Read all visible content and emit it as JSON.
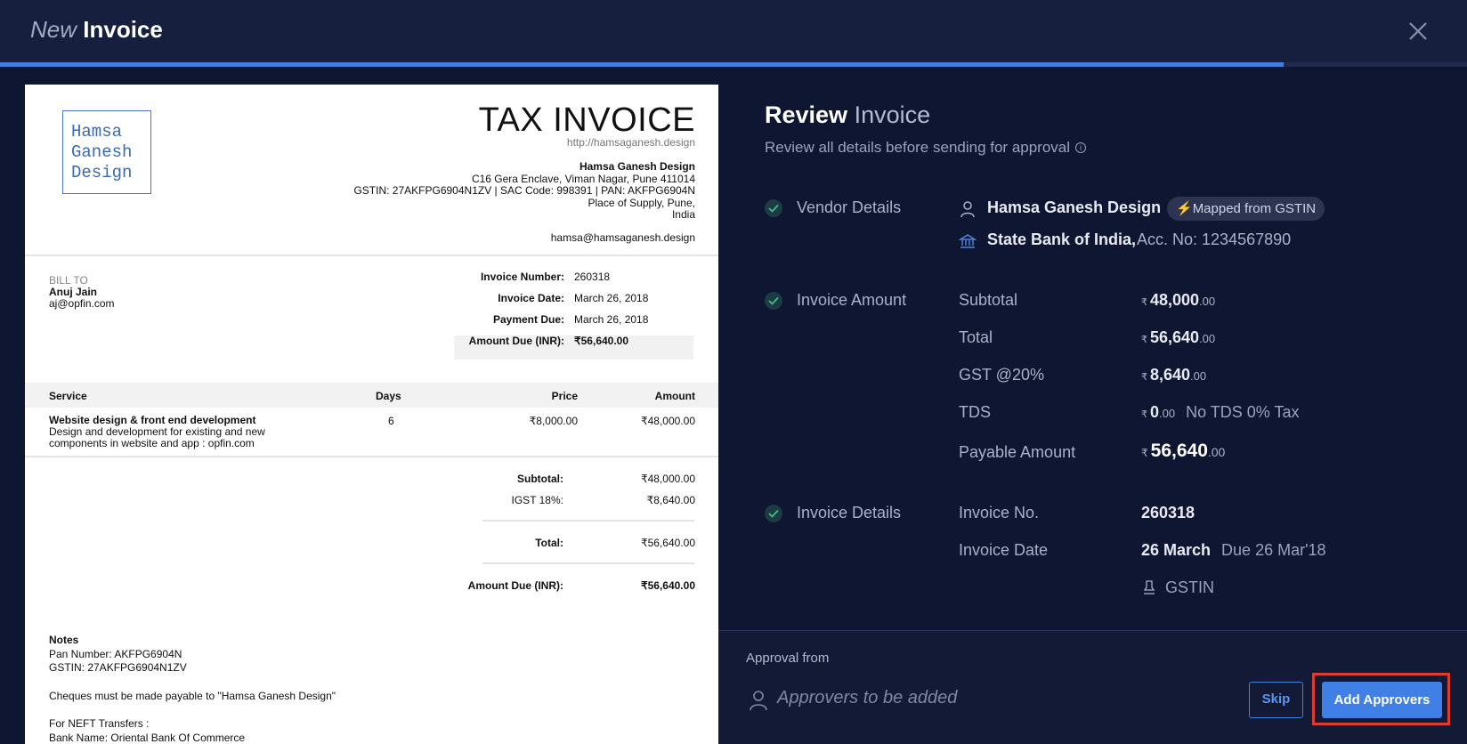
{
  "header": {
    "title_light": "New",
    "title_bold": "Invoice",
    "progress_percent": 87.5
  },
  "document": {
    "logo_lines": [
      "Hamsa",
      "Ganesh",
      "Design"
    ],
    "title": "TAX INVOICE",
    "url": "http://hamsaganesh.design",
    "vendor_name": "Hamsa Ganesh Design",
    "vendor_address": "C16 Gera Enclave, Viman Nagar, Pune 411014",
    "vendor_tax": "GSTIN: 27AKFPG6904N1ZV | SAC Code: 998391 | PAN: AKFPG6904N",
    "vendor_supply": "Place of Supply, Pune,",
    "vendor_country": "India",
    "vendor_email": "hamsa@hamsaganesh.design",
    "bill_to_label": "BILL TO",
    "bill_to_name": "Anuj Jain",
    "bill_to_email": "aj@opfin.com",
    "meta": [
      {
        "label": "Invoice Number:",
        "value": "260318"
      },
      {
        "label": "Invoice Date:",
        "value": "March 26, 2018"
      },
      {
        "label": "Payment Due:",
        "value": "March 26, 2018"
      },
      {
        "label": "Amount Due (INR):",
        "value": "₹56,640.00"
      }
    ],
    "table_headers": {
      "service": "Service",
      "days": "Days",
      "price": "Price",
      "amount": "Amount"
    },
    "item": {
      "name": "Website design & front end development",
      "desc_line1": "Design and development for existing and new",
      "desc_line2": "components in website and app : opfin.com",
      "days": "6",
      "price": "₹8,000.00",
      "amount": "₹48,000.00"
    },
    "totals": {
      "subtotal_label": "Subtotal:",
      "subtotal": "₹48,000.00",
      "igst_label": "IGST 18%:",
      "igst": "₹8,640.00",
      "total_label": "Total:",
      "total": "₹56,640.00",
      "due_label": "Amount Due (INR):",
      "due": "₹56,640.00"
    },
    "notes": {
      "heading": "Notes",
      "pan": "Pan Number: AKFPG6904N",
      "gstin": "GSTIN: 27AKFPG6904N1ZV",
      "cheques": "Cheques must be made payable to \"Hamsa Ganesh Design\"",
      "neft": "For NEFT Transfers :",
      "bank": "Bank Name: Oriental Bank Of Commerce"
    }
  },
  "review": {
    "title_bold": "Review",
    "title_light": "Invoice",
    "subtitle": "Review all details before sending for approval",
    "vendor": {
      "section": "Vendor Details",
      "name": "Hamsa Ganesh Design",
      "badge": "Mapped from GSTIN",
      "bank": "State Bank of India,",
      "account": "Acc. No: 1234567890"
    },
    "amount": {
      "section": "Invoice Amount",
      "currency": "₹",
      "decimals": ".00",
      "subtotal_label": "Subtotal",
      "subtotal": "48,000",
      "total_label": "Total",
      "total": "56,640",
      "gst_label": "GST @20%",
      "gst": "8,640",
      "tds_label": "TDS",
      "tds": "0",
      "tds_note": "No TDS 0% Tax",
      "payable_label": "Payable Amount",
      "payable": "56,640"
    },
    "details": {
      "section": "Invoice Details",
      "no_label": "Invoice No.",
      "no": "260318",
      "date_label": "Invoice Date",
      "date": "26 March",
      "due": "Due 26 Mar'18",
      "gstin": "GSTIN"
    }
  },
  "approval": {
    "label": "Approval from",
    "placeholder": "Approvers to be added",
    "skip": "Skip",
    "add": "Add Approvers"
  }
}
